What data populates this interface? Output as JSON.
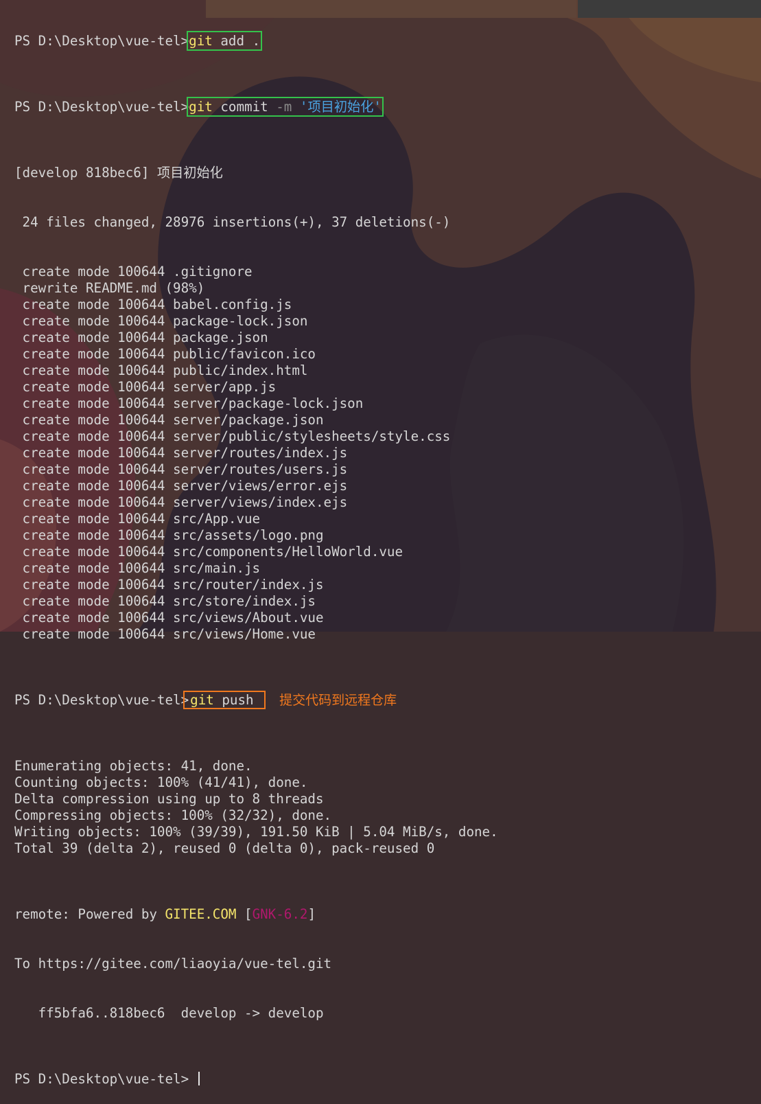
{
  "colors": {
    "command": "#f5e56b",
    "string": "#4aa3e0",
    "highlight_green": "#34c24b",
    "highlight_orange": "#f0781e",
    "gnk": "#b0186c"
  },
  "prompt": "PS D:\\Desktop\\vue-tel>",
  "commands": {
    "add": {
      "cmd": "git",
      "args": "add ."
    },
    "commit": {
      "cmd": "git",
      "args": "commit",
      "flag": "-m",
      "message": "'项目初始化'"
    },
    "push": {
      "cmd": "git",
      "args": "push"
    }
  },
  "commit_output": {
    "header": "[develop 818bec6] 项目初始化",
    "summary": " 24 files changed, 28976 insertions(+), 37 deletions(-)",
    "lines": [
      " create mode 100644 .gitignore",
      " rewrite README.md (98%)",
      " create mode 100644 babel.config.js",
      " create mode 100644 package-lock.json",
      " create mode 100644 package.json",
      " create mode 100644 public/favicon.ico",
      " create mode 100644 public/index.html",
      " create mode 100644 server/app.js",
      " create mode 100644 server/package-lock.json",
      " create mode 100644 server/package.json",
      " create mode 100644 server/public/stylesheets/style.css",
      " create mode 100644 server/routes/index.js",
      " create mode 100644 server/routes/users.js",
      " create mode 100644 server/views/error.ejs",
      " create mode 100644 server/views/index.ejs",
      " create mode 100644 src/App.vue",
      " create mode 100644 src/assets/logo.png",
      " create mode 100644 src/components/HelloWorld.vue",
      " create mode 100644 src/main.js",
      " create mode 100644 src/router/index.js",
      " create mode 100644 src/store/index.js",
      " create mode 100644 src/views/About.vue",
      " create mode 100644 src/views/Home.vue"
    ]
  },
  "push_annotation": "提交代码到远程仓库",
  "push_output": {
    "lines": [
      "Enumerating objects: 41, done.",
      "Counting objects: 100% (41/41), done.",
      "Delta compression using up to 8 threads",
      "Compressing objects: 100% (32/32), done.",
      "Writing objects: 100% (39/39), 191.50 KiB | 5.04 MiB/s, done.",
      "Total 39 (delta 2), reused 0 (delta 0), pack-reused 0"
    ],
    "remote_prefix": "remote: Powered by ",
    "remote_brand": "GITEE.COM",
    "remote_open": " [",
    "remote_gnk": "GNK-6.2",
    "remote_close": "]",
    "to_line": "To https://gitee.com/liaoyia/vue-tel.git",
    "ref_line": "   ff5bfa6..818bec6  develop -> develop"
  }
}
